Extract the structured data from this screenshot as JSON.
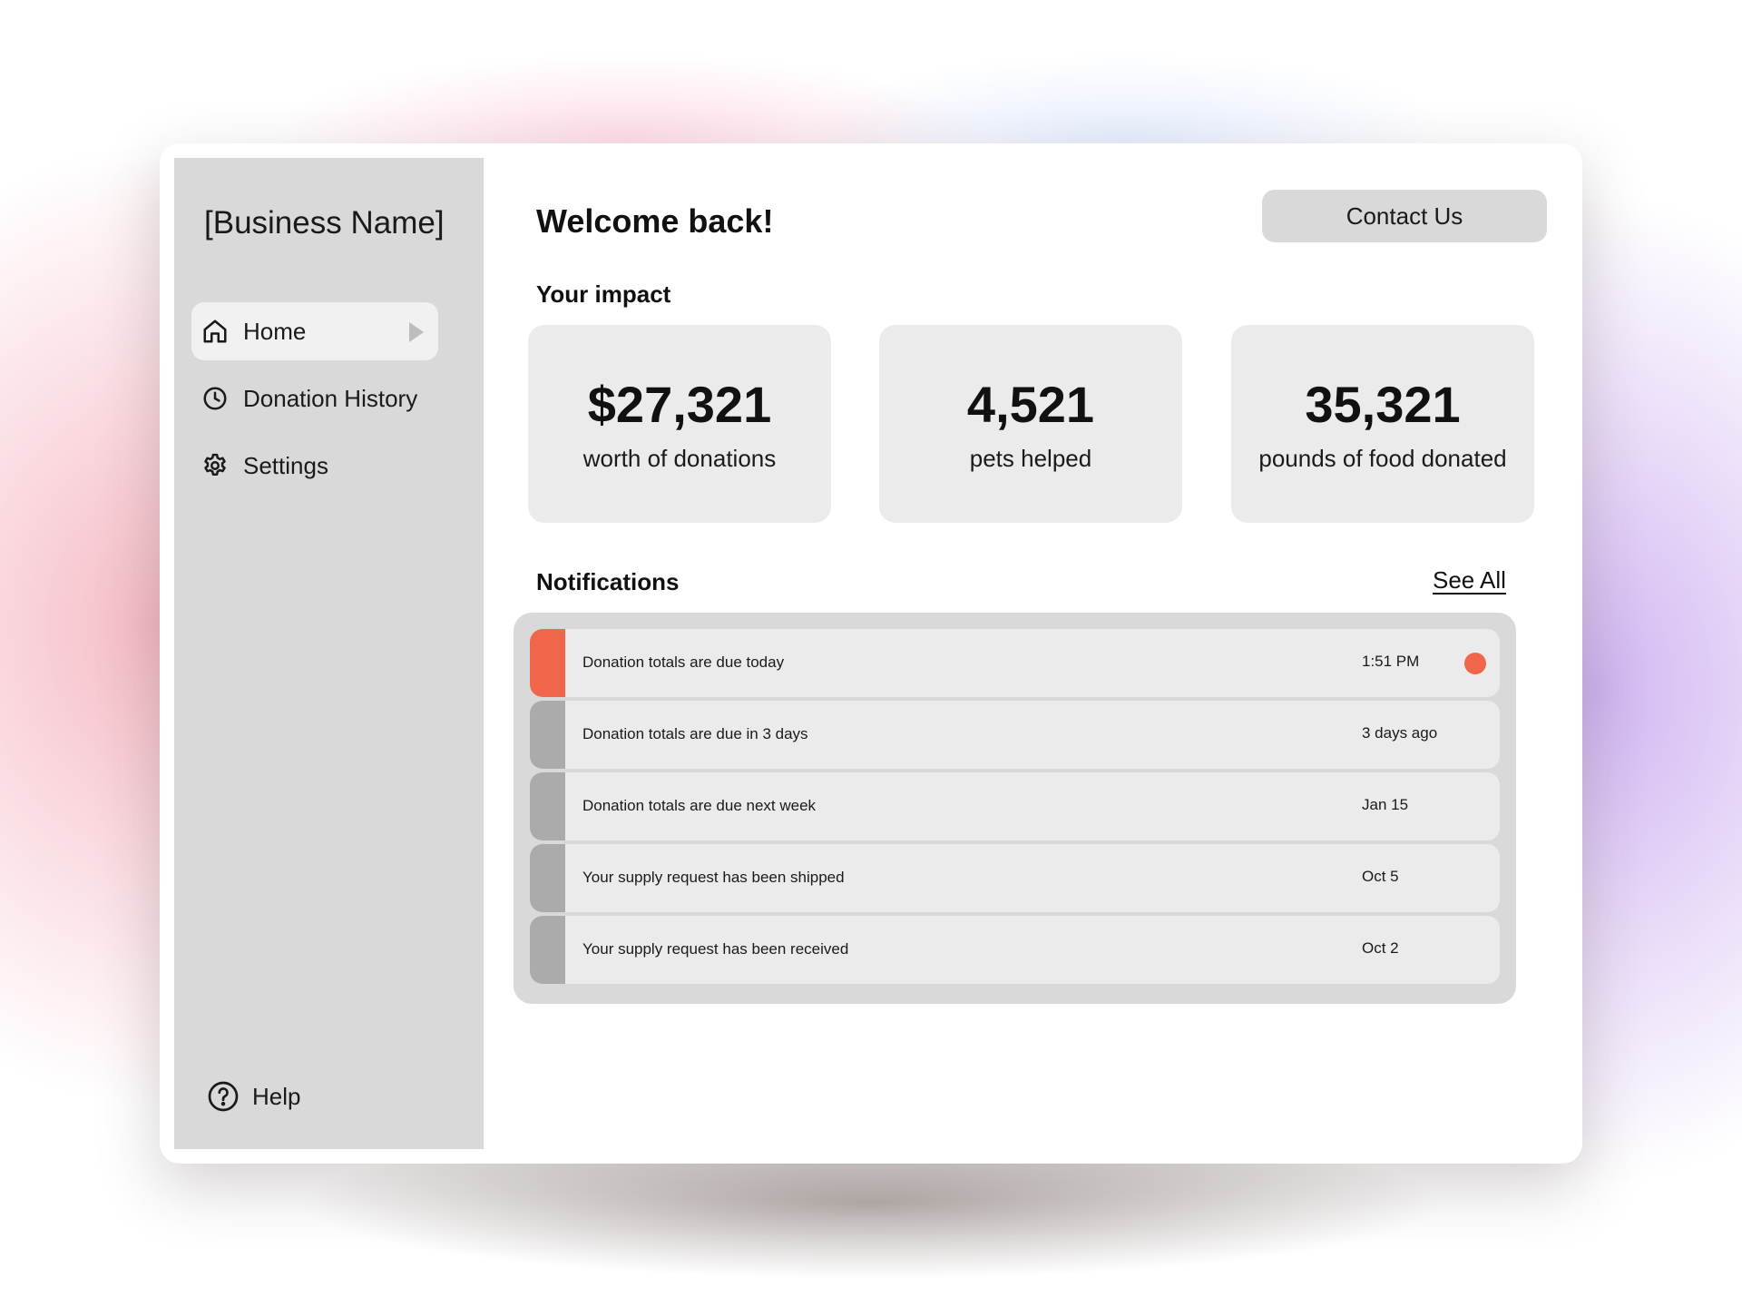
{
  "sidebar": {
    "brand": "[Business Name]",
    "items": [
      {
        "label": "Home",
        "icon": "home-icon",
        "active": true
      },
      {
        "label": "Donation History",
        "icon": "clock-icon",
        "active": false
      },
      {
        "label": "Settings",
        "icon": "gear-icon",
        "active": false
      }
    ],
    "help_label": "Help"
  },
  "header": {
    "welcome": "Welcome back!",
    "contact_label": "Contact Us"
  },
  "impact": {
    "title": "Your impact",
    "cards": [
      {
        "value": "$27,321",
        "label": "worth of donations"
      },
      {
        "value": "4,521",
        "label": "pets helped"
      },
      {
        "value": "35,321",
        "label": "pounds of food donated"
      }
    ]
  },
  "notifications": {
    "title": "Notifications",
    "see_all_label": "See All",
    "items": [
      {
        "text": "Donation totals are due today",
        "time": "1:51 PM",
        "unread": true
      },
      {
        "text": "Donation totals are due in 3 days",
        "time": "3 days ago",
        "unread": false
      },
      {
        "text": "Donation totals are due next week",
        "time": "Jan 15",
        "unread": false
      },
      {
        "text": "Your supply request has been shipped",
        "time": "Oct 5",
        "unread": false
      },
      {
        "text": "Your supply request has been received",
        "time": "Oct 2",
        "unread": false
      }
    ]
  },
  "colors": {
    "accent": "#f0664a",
    "sidebar_bg": "#d9d9d9",
    "card_bg": "#ebebeb",
    "read_marker": "#ababab"
  }
}
